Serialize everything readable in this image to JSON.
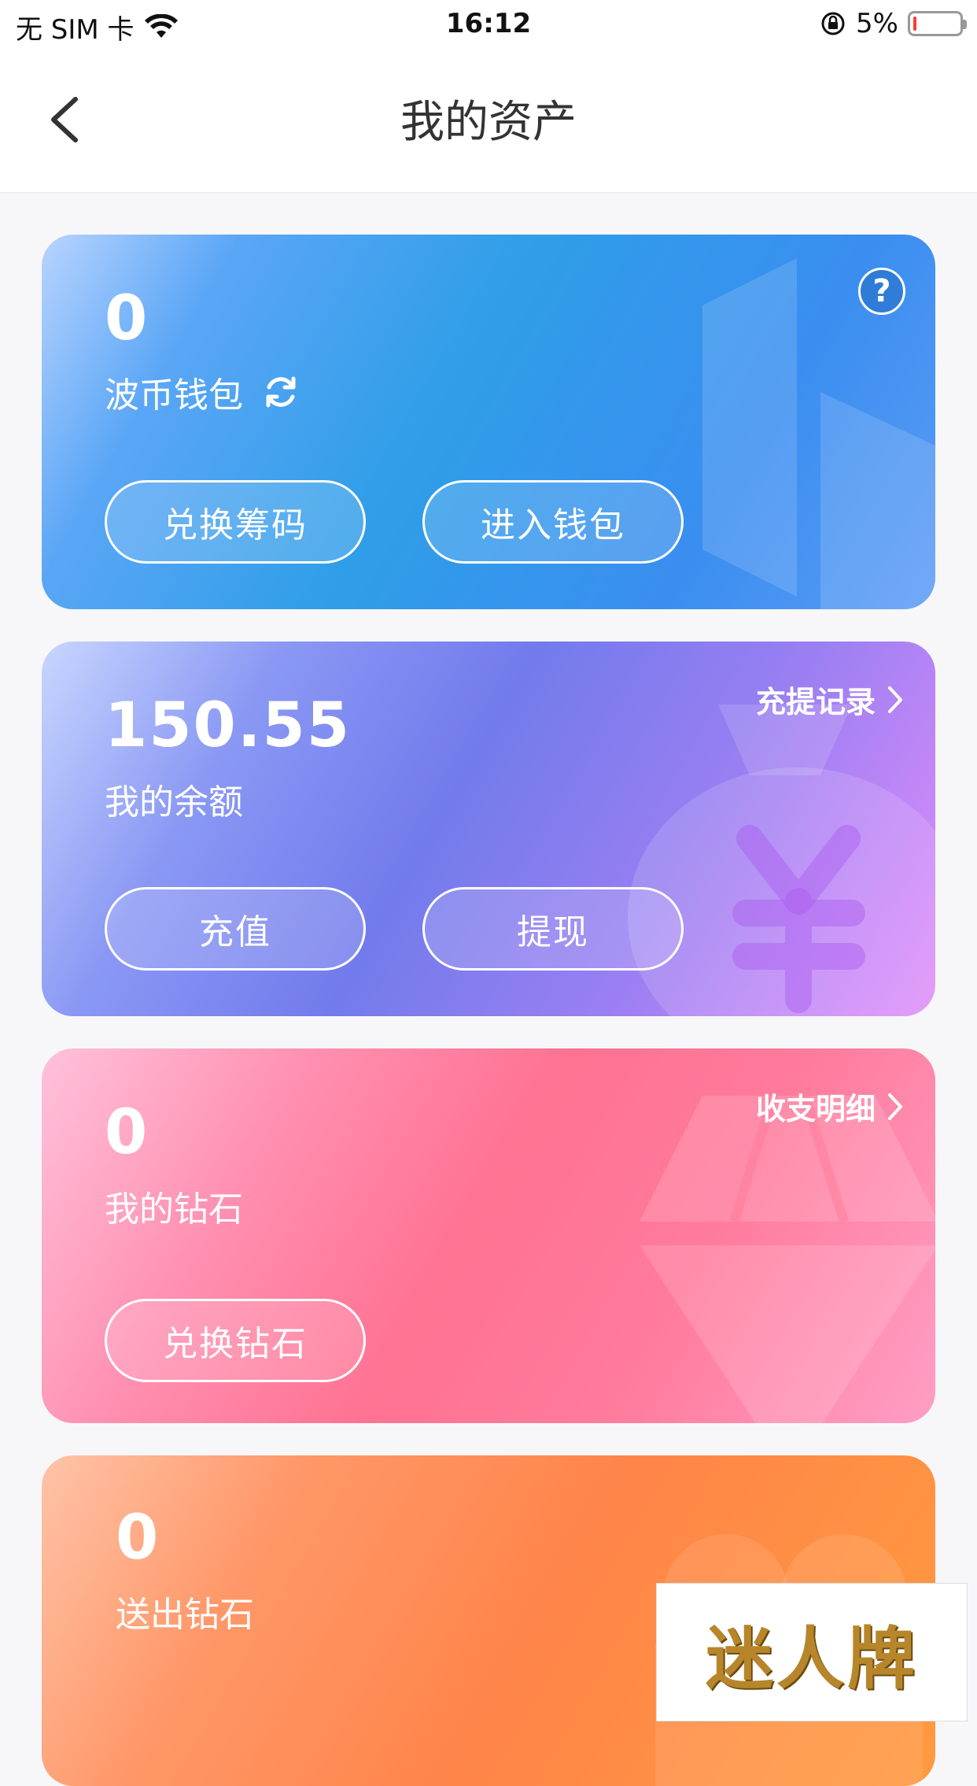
{
  "status_bar": {
    "carrier": "无 SIM 卡",
    "time": "16:12",
    "battery": "5%"
  },
  "nav": {
    "title": "我的资产"
  },
  "wallet_card": {
    "amount": "0",
    "label": "波币钱包",
    "buttons": [
      "兑换筹码",
      "进入钱包"
    ]
  },
  "balance_card": {
    "amount": "150.55",
    "label": "我的余额",
    "link": "充提记录",
    "buttons": [
      "充值",
      "提现"
    ]
  },
  "diamond_card": {
    "amount": "0",
    "label": "我的钻石",
    "link": "收支明细",
    "buttons": [
      "兑换钻石"
    ]
  },
  "sent_card": {
    "amount": "0",
    "label": "送出钻石"
  },
  "watermark": {
    "text": "迷人牌"
  },
  "colors": {
    "wallet": "#2f9ee8",
    "balance": "#727bec",
    "diamond": "#ff7292",
    "sent": "#ff8549"
  }
}
